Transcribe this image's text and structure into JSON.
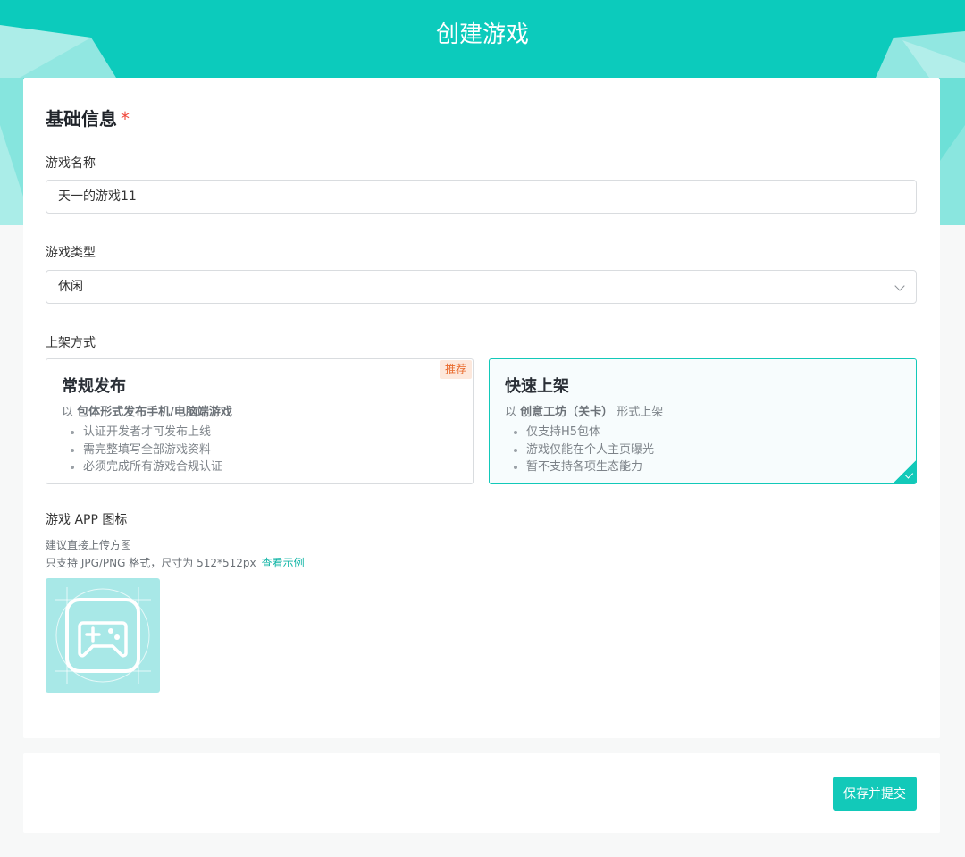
{
  "header": {
    "title": "创建游戏",
    "color": "#0ccbbc"
  },
  "basic_info": {
    "title": "基础信息",
    "required_mark": "*",
    "name_label": "游戏名称",
    "name_value": "天一的游戏11",
    "type_label": "游戏类型",
    "type_value": "休闲",
    "listing_label": "上架方式"
  },
  "listing_options": [
    {
      "title": "常规发布",
      "badge": "推荐",
      "desc_prefix": "以 ",
      "desc_bold": "包体形式发布手机/电脑端游戏",
      "desc_suffix": "",
      "bullets": [
        "认证开发者才可发布上线",
        "需完整填写全部游戏资料",
        "必须完成所有游戏合规认证"
      ],
      "selected": false
    },
    {
      "title": "快速上架",
      "desc_prefix": "以 ",
      "desc_bold": "创意工坊（关卡）",
      "desc_suffix": " 形式上架",
      "bullets": [
        "仅支持H5包体",
        "游戏仅能在个人主页曝光",
        "暂不支持各项生态能力"
      ],
      "selected": true
    }
  ],
  "app_icon": {
    "label": "游戏 APP 图标",
    "hint1": "建议直接上传方图",
    "hint2": "只支持 JPG/PNG 格式，尺寸为 512*512px",
    "example_link": "查看示例",
    "icon": "gamepad-icon"
  },
  "footer": {
    "submit_label": "保存并提交"
  },
  "colors": {
    "accent": "#12c9b9",
    "required": "#f04a3e",
    "badge_text": "#e8692b"
  }
}
